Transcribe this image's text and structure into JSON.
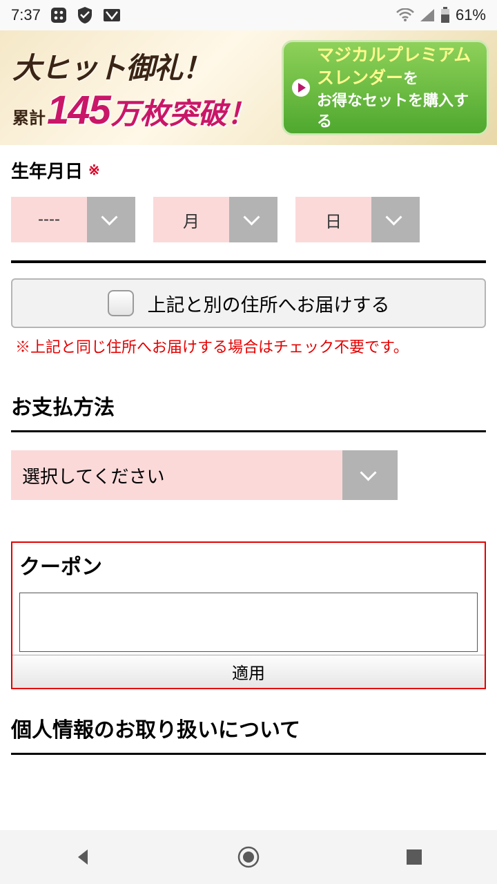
{
  "status": {
    "time": "7:37",
    "battery": "61%"
  },
  "banner": {
    "headline": "大ヒット御礼！",
    "sub_prefix": "累計",
    "sub_number": "145",
    "sub_unit": "万枚突破！",
    "cta_line1": "マジカルプレミアム",
    "cta_line2_a": "スレンダー",
    "cta_line2_b": "を",
    "cta_line3": "お得なセットを購入する"
  },
  "form": {
    "dob_label": "生年月日",
    "required_mark": "※",
    "year_value": "----",
    "month_value": "月",
    "day_value": "日",
    "alt_address_label": "上記と別の住所へお届けする",
    "alt_address_note": "※上記と同じ住所へお届けする場合はチェック不要です。"
  },
  "payment": {
    "title": "お支払方法",
    "select_placeholder": "選択してください"
  },
  "coupon": {
    "title": "クーポン",
    "apply_label": "適用"
  },
  "privacy": {
    "title": "個人情報のお取り扱いについて"
  }
}
